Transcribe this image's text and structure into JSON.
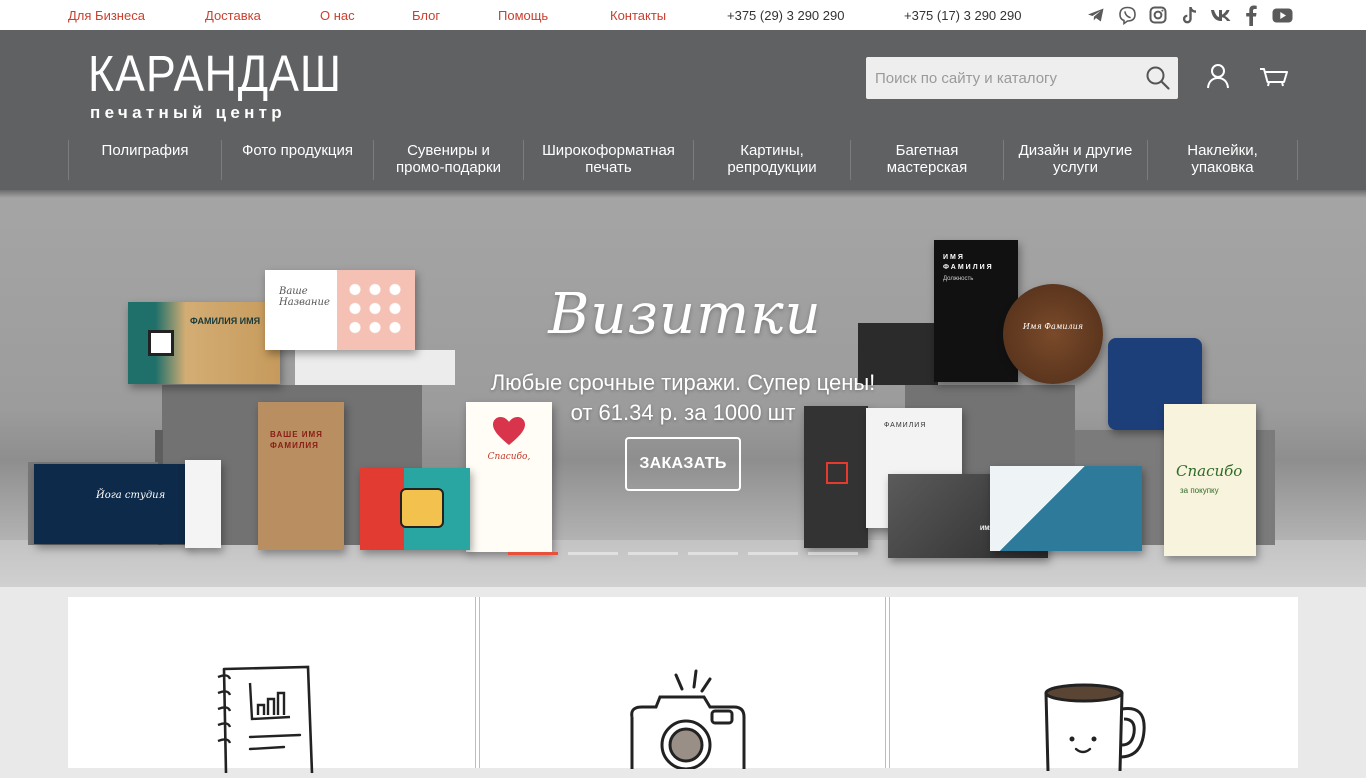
{
  "topbar": {
    "links": [
      "Для Бизнеса",
      "Доставка",
      "О нас",
      "Блог",
      "Помощь",
      "Контакты"
    ],
    "phone1": "+375 (29) 3 290 290",
    "phone2": "+375 (17) 3 290 290",
    "social": [
      "telegram-icon",
      "viber-icon",
      "instagram-icon",
      "tiktok-icon",
      "vk-icon",
      "facebook-icon",
      "youtube-icon"
    ]
  },
  "header": {
    "logo_main": "КАРАНДАШ",
    "logo_sub": "печатный центр",
    "search_placeholder": "Поиск по сайту и каталогу"
  },
  "nav": [
    "Полиграфия",
    "Фото продукция",
    "Сувениры и промо-подарки",
    "Широкоформатная печать",
    "Картины, репродукции",
    "Багетная мастерская",
    "Дизайн и другие услуги",
    "Наклейки, упаковка"
  ],
  "hero": {
    "title": "Визитки",
    "subtitle_line1": "Любые срочные тиражи. Супер цены!",
    "subtitle_line2": "от 61.34 р. за 1000 шт",
    "button": "ЗАКАЗАТЬ",
    "slides_total": 6,
    "active_slide": 1
  },
  "cards": {
    "card1_title": "ФАМИЛИЯ ИМЯ",
    "card2_title": "Ваше Название",
    "card3_line1": "ИМЯ",
    "card3_line2": "ФАМИЛИЯ",
    "card3_role": "Должность",
    "card4_text": "Имя Фамилия",
    "card5_line1": "ВАШЕ ИМЯ",
    "card5_line2": "ФАМИЛИЯ",
    "card6_text": "Спасибо,",
    "card7_text": "Йога студия",
    "card8_text": "ФАМИЛИЯ",
    "card9_text": "ИМЯ ФАМИЛИЯ",
    "card10_text": "Спасибо",
    "card10_sub": "за покупку"
  },
  "colors": {
    "accent": "#c9402f",
    "header_bg": "#5f6163",
    "active_dot": "#e8503a"
  }
}
